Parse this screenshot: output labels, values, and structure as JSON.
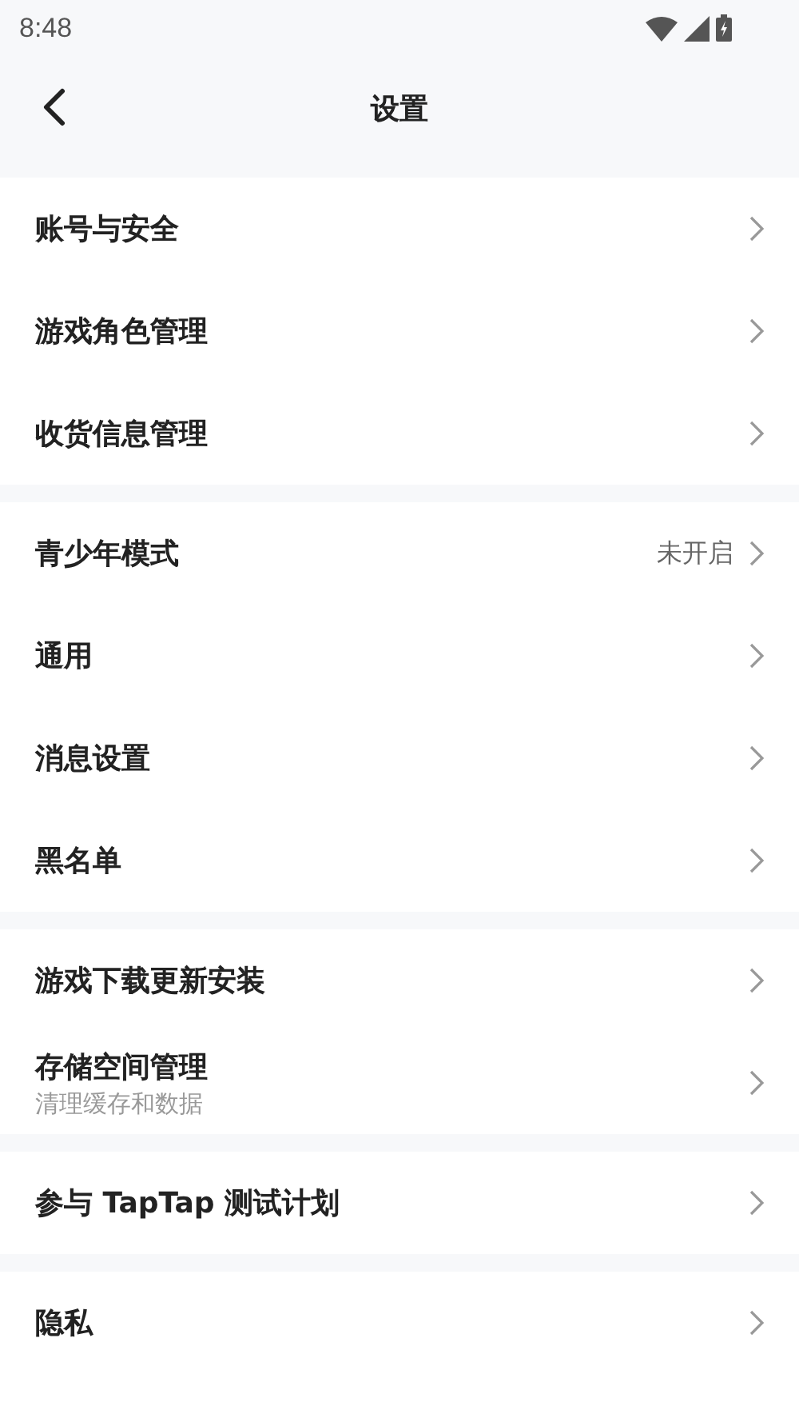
{
  "status_bar": {
    "time": "8:48"
  },
  "header": {
    "title": "设置"
  },
  "groups": [
    {
      "items": [
        {
          "label": "账号与安全"
        },
        {
          "label": "游戏角色管理"
        },
        {
          "label": "收货信息管理"
        }
      ]
    },
    {
      "items": [
        {
          "label": "青少年模式",
          "value": "未开启"
        },
        {
          "label": "通用"
        },
        {
          "label": "消息设置"
        },
        {
          "label": "黑名单"
        }
      ]
    },
    {
      "items": [
        {
          "label": "游戏下载更新安装"
        },
        {
          "label": "存储空间管理",
          "subtitle": "清理缓存和数据"
        }
      ]
    },
    {
      "items": [
        {
          "label": "参与 TapTap 测试计划"
        }
      ]
    },
    {
      "items": [
        {
          "label": "隐私"
        }
      ]
    }
  ]
}
